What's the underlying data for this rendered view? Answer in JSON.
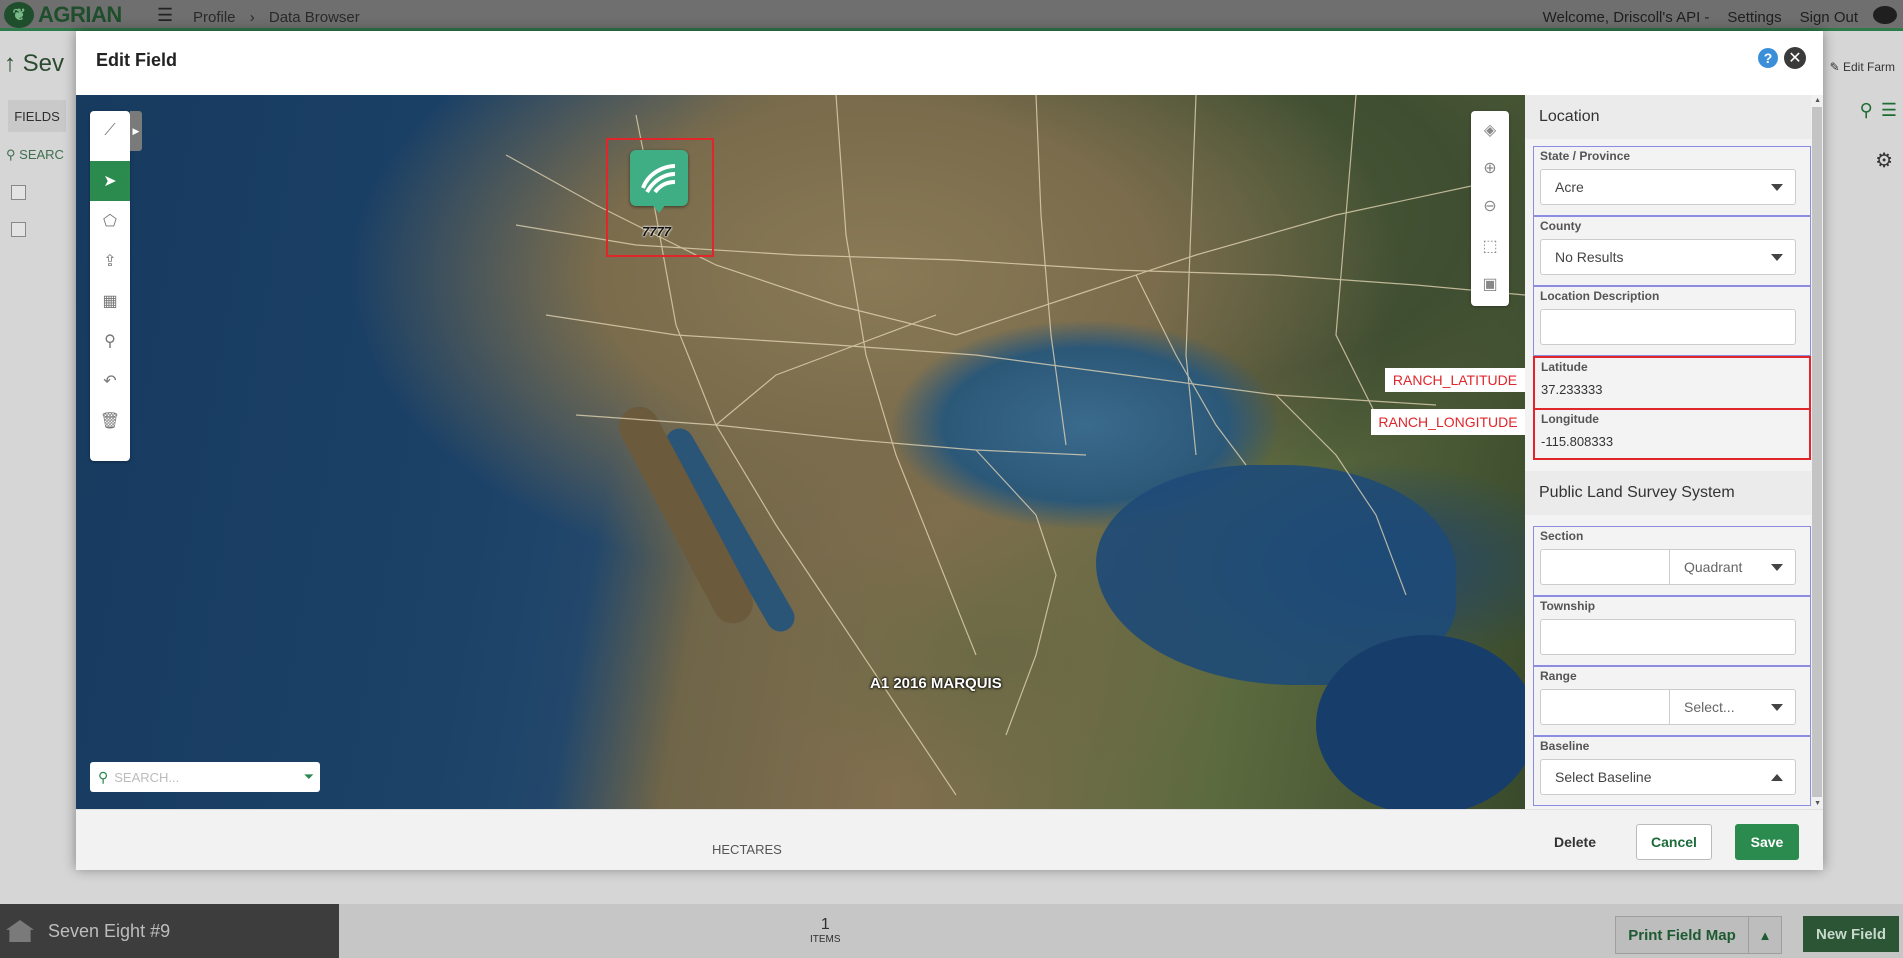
{
  "colors": {
    "accent": "#2b8a4e",
    "highlight_red": "#e0262b",
    "field_outline": "#8c8ce0",
    "help_blue": "#3b8fd9"
  },
  "app": {
    "logo_text": "AGRIAN",
    "breadcrumbs": [
      "Profile",
      "Data Browser"
    ],
    "top_links": [
      "Welcome, Driscoll's API -",
      "Settings",
      "Sign Out"
    ],
    "page_title": "Sev",
    "edit_farm": "Edit Farm",
    "tab_fields": "FIELDS",
    "search_placeholder": "SEARC",
    "farm_name": "Seven Eight #9",
    "items_count": "1",
    "items_label": "ITEMS",
    "print_field_map": "Print Field Map",
    "new_field": "New Field"
  },
  "modal": {
    "title": "Edit Field",
    "help_icon": "question-circle-icon",
    "close_icon": "close-icon",
    "map": {
      "marker_label": "7777",
      "field_label": "A1 2016 MARQUIS",
      "search_placeholder": "SEARCH...",
      "annotation_latitude": "RANCH_LATITUDE",
      "annotation_longitude": "RANCH_LONGITUDE",
      "tools": [
        "measure-icon",
        "select-arrow-icon",
        "draw-polygon-icon",
        "upload-icon",
        "layers-grid-icon",
        "place-marker-icon",
        "undo-icon",
        "delete-icon"
      ],
      "zoom_tools": [
        "layers-icon",
        "zoom-in-icon",
        "zoom-out-icon",
        "zoom-selection-icon",
        "zoom-extent-icon"
      ]
    },
    "panel": {
      "location_heading": "Location",
      "state_label": "State / Province",
      "state_value": "Acre",
      "county_label": "County",
      "county_value": "No Results",
      "location_description_label": "Location Description",
      "location_description_value": "",
      "latitude_label": "Latitude",
      "latitude_value": "37.233333",
      "longitude_label": "Longitude",
      "longitude_value": "-115.808333",
      "plss_heading": "Public Land Survey System",
      "section_label": "Section",
      "section_value": "",
      "quadrant_placeholder": "Quadrant",
      "township_label": "Township",
      "township_value": "",
      "range_label": "Range",
      "range_value": "",
      "range_select_placeholder": "Select...",
      "baseline_label": "Baseline",
      "baseline_placeholder": "Select Baseline",
      "required_mark": "*"
    },
    "footer": {
      "units_label": "HECTARES",
      "delete": "Delete",
      "cancel": "Cancel",
      "save": "Save"
    }
  }
}
